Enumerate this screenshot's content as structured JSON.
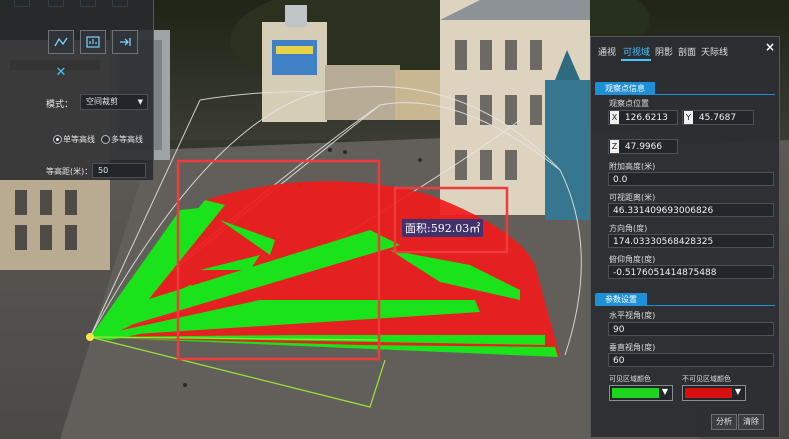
{
  "scene": {
    "area_label": "面积:592.03㎡",
    "colors": {
      "visible": "#1be31b",
      "invisible": "#ef1b1b",
      "highlight_box": "#ee3b3b"
    }
  },
  "left_panel": {
    "toolbar_icons": [
      "measure-icon",
      "chart-icon",
      "export-icon",
      "close-icon"
    ],
    "mode_label": "模式：",
    "mode_value": "空间裁剪",
    "radio_single": "单等高线",
    "radio_multi": "多等高线",
    "contour_label": "等高距(米)：",
    "contour_value": "50"
  },
  "right_panel": {
    "tabs": [
      "通视",
      "可视域",
      "阴影",
      "剖面",
      "天际线"
    ],
    "active_tab": "可视域",
    "close_label": "×",
    "observer_section": "观察点信息",
    "observer_pos_label": "观察点位置",
    "x_tag": "X",
    "x_value": "126.6213",
    "y_tag": "Y",
    "y_value": "45.7687",
    "z_tag": "Z",
    "z_value": "47.9966",
    "extra_height_label": "附加高度(米)",
    "extra_height_value": "0.0",
    "view_distance_label": "可视距离(米)",
    "view_distance_value": "46.331409693006826",
    "direction_label": "方向角(度)",
    "direction_value": "174.03330568428325",
    "pitch_label": "俯仰角度(度)",
    "pitch_value": "-0.5176051414875488",
    "param_section": "参数设置",
    "hfov_label": "水平视角(度)",
    "hfov_value": "90",
    "vfov_label": "垂直视角(度)",
    "vfov_value": "60",
    "visible_color_label": "可见区域颜色",
    "invisible_color_label": "不可见区域颜色",
    "analyze_button": "分析",
    "clear_button": "清除"
  }
}
